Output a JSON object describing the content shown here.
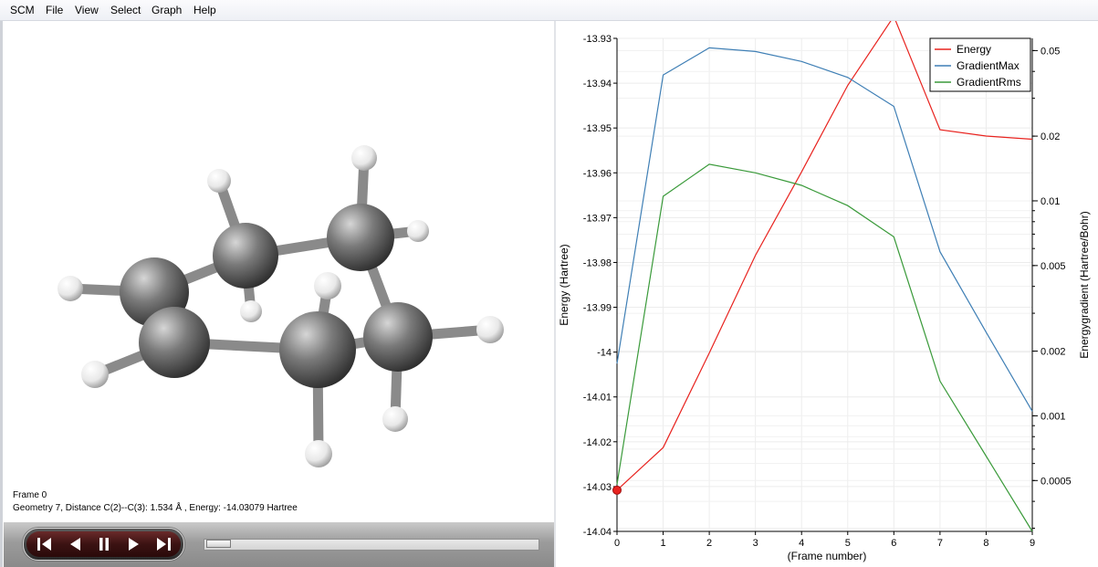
{
  "menu": [
    "SCM",
    "File",
    "View",
    "Select",
    "Graph",
    "Help"
  ],
  "status": {
    "frame": "Frame 0",
    "geometry": "Geometry 7, Distance C(2)--C(3): 1.534 Å , Energy: -14.03079 Hartree"
  },
  "player": {
    "buttons": [
      "first-frame",
      "previous-frame",
      "pause",
      "next-frame",
      "last-frame"
    ],
    "slider_position": 0
  },
  "chart_data": {
    "type": "line",
    "xlabel": "(Frame number)",
    "ylabel_left": "Energy (Hartree)",
    "ylabel_right": "Energygradient (Hartree/Bohr)",
    "x": [
      0,
      1,
      2,
      3,
      4,
      5,
      6,
      7,
      8,
      9
    ],
    "x_ticks": [
      "0",
      "1",
      "2",
      "3",
      "4",
      "5",
      "6",
      "7",
      "8",
      "9"
    ],
    "y_left_ticks": [
      "-13.93",
      "-13.94",
      "-13.95",
      "-13.96",
      "-13.97",
      "-13.98",
      "-13.99",
      "-14",
      "-14.01",
      "-14.02",
      "-14.03",
      "-14.04"
    ],
    "y_left_range": [
      -14.04,
      -13.93
    ],
    "y_right_ticks": [
      "0.05",
      "0.02",
      "0.01",
      "0.005",
      "0.002",
      "0.001",
      "0.0005"
    ],
    "y_right_scale": "log",
    "y_right_range": [
      0.00029,
      0.057
    ],
    "legend_position": "top-right",
    "grid": true,
    "current_frame": 0,
    "series": [
      {
        "name": "Energy",
        "axis": "left",
        "color": "#e8231f",
        "values": [
          -14.0308,
          -14.0213,
          -14.0002,
          -13.9784,
          -13.9598,
          -13.9405,
          -13.9251,
          -13.9504,
          -13.9518,
          -13.9525
        ]
      },
      {
        "name": "GradientMax",
        "axis": "right",
        "color": "#3f7fb5",
        "values": [
          0.00175,
          0.0385,
          0.0515,
          0.0495,
          0.0445,
          0.0375,
          0.0275,
          0.0058,
          0.00245,
          0.00105
        ]
      },
      {
        "name": "GradientRms",
        "axis": "right",
        "color": "#3a9a3a",
        "values": [
          0.00048,
          0.0105,
          0.0148,
          0.0135,
          0.0118,
          0.0095,
          0.0068,
          0.00145,
          0.00065,
          0.00029
        ]
      }
    ]
  }
}
